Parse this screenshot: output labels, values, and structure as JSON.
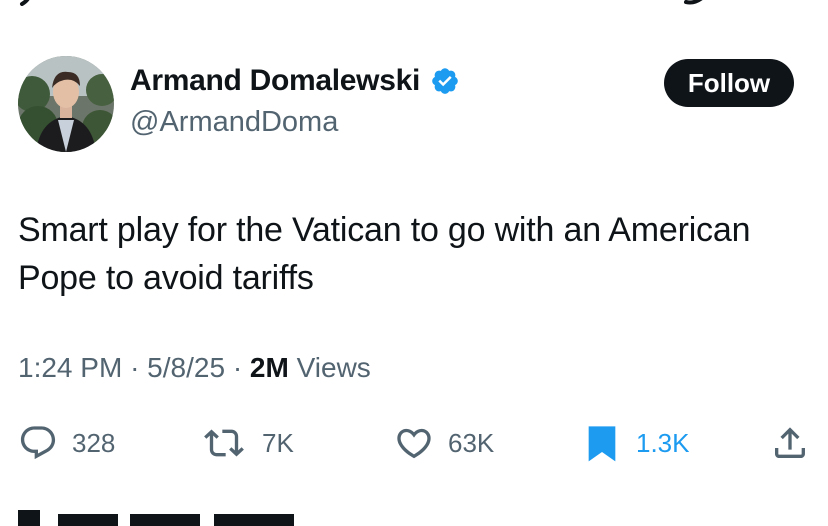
{
  "author": {
    "name": "Armand Domalewski",
    "handle": "@ArmandDoma",
    "verified": true
  },
  "follow_label": "Follow",
  "tweet": {
    "text": "Smart play for the Vatican to go with an American Pope to avoid tariffs",
    "time": "1:24 PM",
    "date": "5/8/25",
    "views_count": "2M",
    "views_label": "Views"
  },
  "actions": {
    "replies": "328",
    "reposts": "7K",
    "likes": "63K",
    "bookmarks": "1.3K"
  },
  "icons": [
    "reply-icon",
    "repost-icon",
    "like-icon",
    "bookmark-icon",
    "share-icon",
    "verified-icon"
  ],
  "colors": {
    "accent": "#1d9bf0",
    "text": "#0f1419",
    "muted": "#536471",
    "button_bg": "#0f1419"
  }
}
